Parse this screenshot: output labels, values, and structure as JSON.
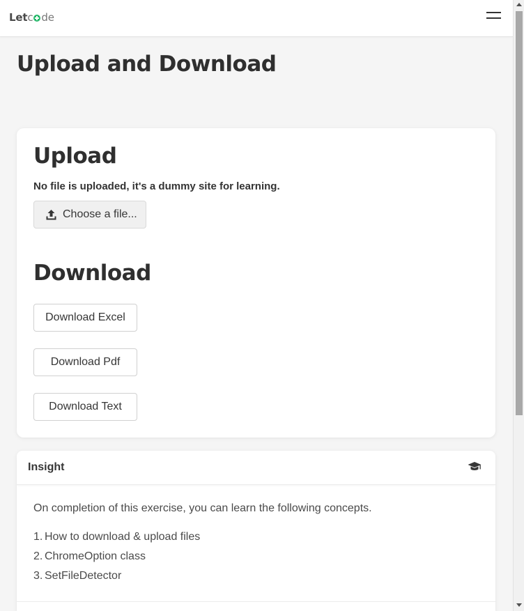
{
  "brand": {
    "let": "Let",
    "c": "c",
    "de": "de"
  },
  "page": {
    "title": "Upload and Download"
  },
  "upload": {
    "heading": "Upload",
    "note": "No file is uploaded, it's a dummy site for learning.",
    "choose_label": "Choose a file..."
  },
  "download": {
    "heading": "Download",
    "buttons": [
      "Download Excel",
      "Download Pdf",
      "Download Text"
    ]
  },
  "insight": {
    "title": "Insight",
    "intro": "On completion of this exercise, you can learn the following concepts.",
    "concepts": [
      {
        "num": "1.",
        "text": "How to download & upload files"
      },
      {
        "num": "2.",
        "text": "ChromeOption class"
      },
      {
        "num": "3.",
        "text": "SetFileDetector"
      }
    ]
  },
  "colors": {
    "brand_green": "#26b86a",
    "text": "#363636"
  },
  "icons": [
    "menu-icon",
    "upload-icon",
    "graduation-cap-icon"
  ]
}
